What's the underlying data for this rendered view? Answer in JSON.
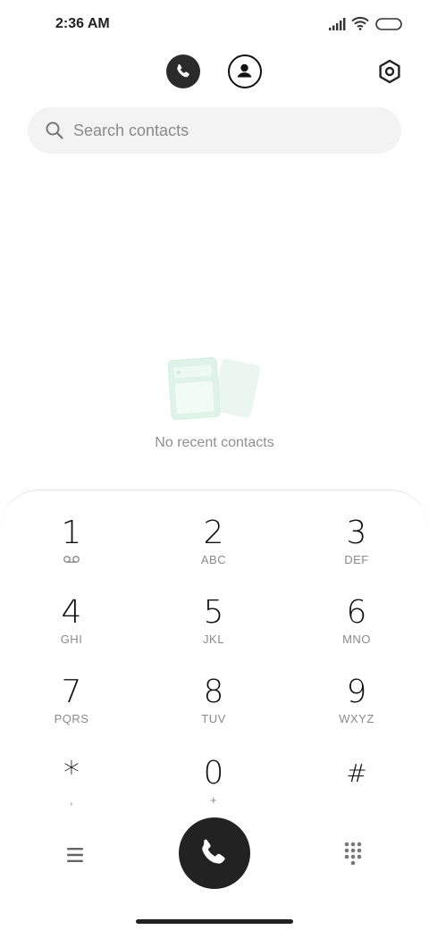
{
  "status_bar": {
    "time": "2:36 AM"
  },
  "header": {
    "tabs": [
      {
        "name": "calls",
        "icon": "phone-icon",
        "active": true
      },
      {
        "name": "contacts",
        "icon": "person-icon",
        "active": false
      }
    ],
    "settings_icon": "gear-icon"
  },
  "search": {
    "placeholder": "Search contacts"
  },
  "empty_state": {
    "message": "No recent contacts"
  },
  "dialpad": {
    "keys": [
      {
        "digit": "1",
        "letters": "voicemail-icon"
      },
      {
        "digit": "2",
        "letters": "ABC"
      },
      {
        "digit": "3",
        "letters": "DEF"
      },
      {
        "digit": "4",
        "letters": "GHI"
      },
      {
        "digit": "5",
        "letters": "JKL"
      },
      {
        "digit": "6",
        "letters": "MNO"
      },
      {
        "digit": "7",
        "letters": "PQRS"
      },
      {
        "digit": "8",
        "letters": "TUV"
      },
      {
        "digit": "9",
        "letters": "WXYZ"
      },
      {
        "digit": "*",
        "letters": ","
      },
      {
        "digit": "0",
        "letters": "+"
      },
      {
        "digit": "#",
        "letters": ""
      }
    ]
  },
  "colors": {
    "accent_dark": "#222222",
    "illustration_green": "#dff3e8"
  }
}
